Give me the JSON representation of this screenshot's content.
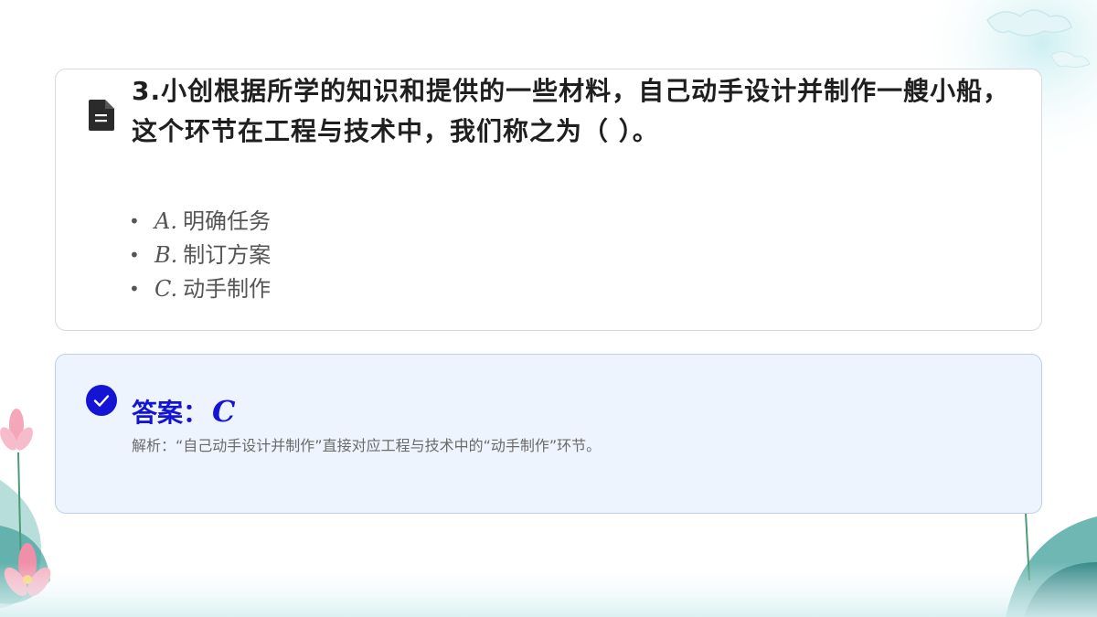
{
  "question": {
    "number": "3.",
    "text": "小创根据所学的知识和提供的一些材料，自己动手设计并制作一艘小船，这个环节在工程与技术中，我们称之为（ ）。",
    "options": [
      {
        "letter": "A.",
        "text": "明确任务"
      },
      {
        "letter": "B.",
        "text": "制订方案"
      },
      {
        "letter": "C.",
        "text": "动手制作"
      }
    ]
  },
  "answer": {
    "label": "答案：",
    "value": "C",
    "explanation": "解析：“自己动手设计并制作”直接对应工程与技术中的“动手制作”环节。"
  },
  "icons": {
    "question": "document-icon",
    "answer": "check-circle-icon"
  },
  "colors": {
    "answer_accent": "#1414d4",
    "answer_bg": "#eef4fd"
  }
}
